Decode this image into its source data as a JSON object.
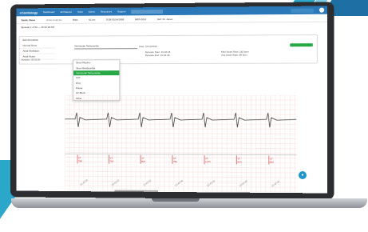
{
  "topnav": {
    "logo": "eCardiology",
    "items": [
      "Dashboard",
      "All Patients",
      "Tests",
      "Admin",
      "Resources",
      "Support"
    ],
    "colors": {
      "bar": "#2a78b7"
    }
  },
  "patient_bar": {
    "name": "Smith, Steve",
    "sub": "Holter Analysis",
    "fields": [
      "Male",
      "62 yrs",
      "DOB 05/14/1958",
      "MRN 0012",
      "Ref: Dr. Jones"
    ]
  },
  "breadcrumb": "Episode 1 of 52 — 10:42:18 AM",
  "panel": {
    "title": "Edit Annotation",
    "sidebar": [
      "Normal Sinus",
      "Atrial Fibrillation",
      "Atrial Flutter"
    ],
    "select_value": "Ventricular Tachycardia",
    "date": "Date: 10/12/2016",
    "notes": [
      "Episode Start: 10:42:18",
      "Episode End: 10:42:49",
      "Max Heart Rate: 162 bpm",
      "Avg Heart Rate: 98 bpm"
    ],
    "duration": "Duration: 00:00:31"
  },
  "dropdown": {
    "items": [
      "Sinus Rhythm",
      "Sinus Bradycardia",
      "Ventricular Tachycardia",
      "SVT",
      "PVC",
      "Pause",
      "AV Block",
      "Other"
    ],
    "selected_index": 2,
    "accent": "#27a745"
  },
  "ecg": {
    "beats": [
      "VT",
      "VT",
      "VT",
      "VT",
      "VT",
      "VT",
      "VT"
    ],
    "rr": [
      "780",
      "782",
      "800",
      "782",
      "1275",
      "824",
      "820"
    ],
    "time_ticks": [
      "10:42:20",
      "10:42:22",
      "10:42:24",
      "10:42:26",
      "10:42:28",
      "10:42:30",
      "10:42:32"
    ],
    "trace_color": "#444444",
    "grid_color": "#f3c6c6"
  }
}
